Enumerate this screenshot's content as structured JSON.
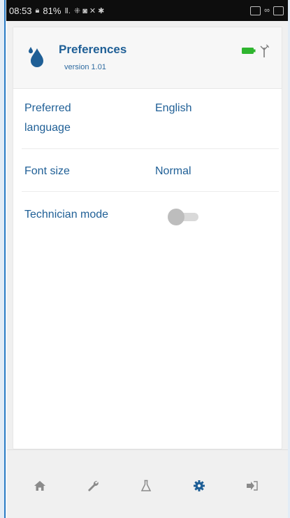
{
  "status_bar": {
    "time": "08:53",
    "battery_percent": "81%",
    "signal_text": "Ⅱ.",
    "extra_glyphs": "⁜ ◙ ✕ ✱"
  },
  "header": {
    "title": "Preferences",
    "version": "version 1.01",
    "icons": [
      "water-drop-icon",
      "battery-icon",
      "antenna-icon"
    ]
  },
  "settings": [
    {
      "label": "Preferred\nlanguage",
      "value": "English"
    },
    {
      "label": "Font size",
      "value": "Normal"
    },
    {
      "label": "Technician mode",
      "value": "",
      "toggle_on": false
    }
  ],
  "bottom_nav": {
    "items": [
      "home-icon",
      "wrench-icon",
      "flask-icon",
      "gear-icon",
      "logout-icon"
    ],
    "active": "gear-icon"
  },
  "colors": {
    "accent": "#1f5f96",
    "nav_active": "#1f5f96",
    "nav_inactive": "#8a8a8a",
    "battery": "#2fb52f"
  }
}
